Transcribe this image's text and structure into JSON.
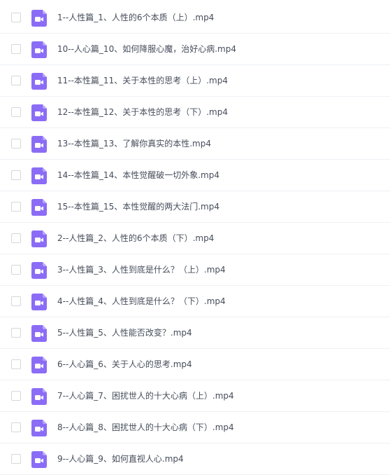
{
  "icon": {
    "name": "video-file-icon",
    "color": "#8b6cf6",
    "fold_color": "#b8a6fb"
  },
  "files": [
    {
      "name": "1--人性篇_1、人性的6个本质（上）.mp4"
    },
    {
      "name": "10--人心篇_10、如何降服心魔，治好心病.mp4"
    },
    {
      "name": "11--本性篇_11、关于本性的思考（上）.mp4"
    },
    {
      "name": "12--本性篇_12、关于本性的思考（下）.mp4"
    },
    {
      "name": "13--本性篇_13、了解你真实的本性.mp4"
    },
    {
      "name": "14--本性篇_14、本性觉醒破一切外象.mp4"
    },
    {
      "name": "15--本性篇_15、本性觉醒的两大法门.mp4"
    },
    {
      "name": "2--人性篇_2、人性的6个本质（下）.mp4"
    },
    {
      "name": "3--人性篇_3、人性到底是什么？（上）.mp4"
    },
    {
      "name": "4--人性篇_4、人性到底是什么？（下）.mp4"
    },
    {
      "name": "5--人性篇_5、人性能否改变？.mp4"
    },
    {
      "name": "6--人心篇_6、关于人心的思考.mp4"
    },
    {
      "name": "7--人心篇_7、困扰世人的十大心病（上）.mp4"
    },
    {
      "name": "8--人心篇_8、困扰世人的十大心病（下）.mp4"
    },
    {
      "name": "9--人心篇_9、如何直视人心.mp4"
    }
  ]
}
